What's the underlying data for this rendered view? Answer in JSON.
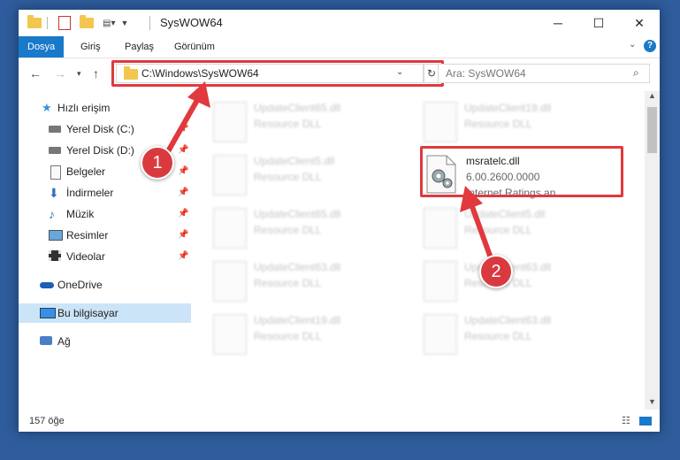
{
  "window": {
    "title": "SysWOW64"
  },
  "ribbon": {
    "tabs": [
      "Dosya",
      "Giriş",
      "Paylaş",
      "Görünüm"
    ]
  },
  "address": {
    "path": "C:\\Windows\\SysWOW64",
    "search_placeholder": "Ara: SysWOW64"
  },
  "sidebar": {
    "items": [
      {
        "label": "Hızlı erişim",
        "icon": "star-icon"
      },
      {
        "label": "Yerel Disk (C:)",
        "icon": "drive-icon",
        "pinned": true
      },
      {
        "label": "Yerel Disk (D:)",
        "icon": "drive-icon",
        "pinned": true
      },
      {
        "label": "Belgeler",
        "icon": "documents-icon",
        "pinned": true
      },
      {
        "label": "İndirmeler",
        "icon": "download-icon",
        "pinned": true
      },
      {
        "label": "Müzik",
        "icon": "music-icon",
        "pinned": true
      },
      {
        "label": "Resimler",
        "icon": "pictures-icon",
        "pinned": true
      },
      {
        "label": "Videolar",
        "icon": "videos-icon",
        "pinned": true
      },
      {
        "label": "OneDrive",
        "icon": "cloud-icon"
      },
      {
        "label": "Bu bilgisayar",
        "icon": "computer-icon",
        "selected": true
      },
      {
        "label": "Ağ",
        "icon": "network-icon"
      }
    ]
  },
  "files": {
    "highlighted": {
      "name": "msratelc.dll",
      "version": "6.00.2600.0000",
      "description": "Internet Ratings an..."
    },
    "blurred": [
      {
        "name": "UpdateClient65.dll",
        "desc": "Resource DLL"
      },
      {
        "name": "UpdateClient19.dll",
        "desc": "Resource DLL"
      },
      {
        "name": "UpdateClient5.dll",
        "desc": "Resource DLL"
      },
      {
        "name": "UpdateClient65.dll",
        "desc": "Resource DLL"
      },
      {
        "name": "UpdateClient5.dll",
        "desc": "Resource DLL"
      },
      {
        "name": "UpdateClient63.dll",
        "desc": "Resource DLL"
      },
      {
        "name": "UpdateClient63.dll",
        "desc": "Resource DLL"
      },
      {
        "name": "UpdateClient19.dll",
        "desc": "Resource DLL"
      },
      {
        "name": "UpdateClient63.dll",
        "desc": "Resource DLL"
      }
    ]
  },
  "status": {
    "count": "157 öğe"
  },
  "annotations": {
    "step1": "1",
    "step2": "2"
  },
  "colors": {
    "accent": "#1979ca",
    "highlight": "#e0393e",
    "desktop": "#2e5c9c"
  }
}
